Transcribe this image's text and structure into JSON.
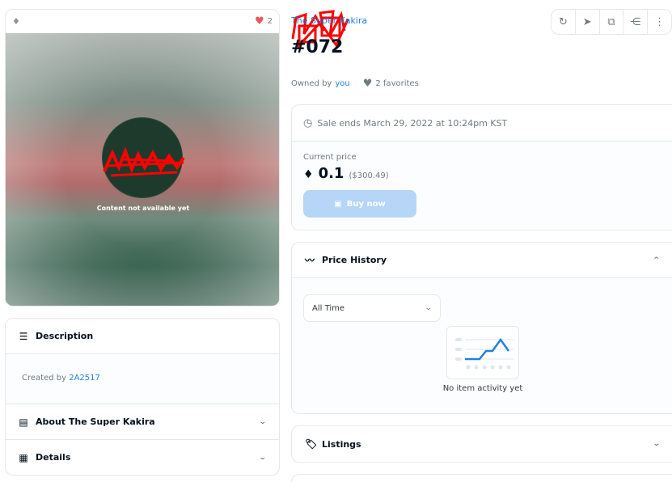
{
  "media": {
    "chain_icon": "ethereum-icon",
    "favorite_count": "2",
    "caption": "Content not available yet"
  },
  "description": {
    "header": "Description",
    "created_by_label": "Created by",
    "creator": "2A2517"
  },
  "about": {
    "header": "About The Super Kakira"
  },
  "details": {
    "header": "Details"
  },
  "item": {
    "collection_link": "The Super Kakira",
    "name": "#072",
    "owned_by_label": "Owned by",
    "owner": "you",
    "favorites": "2 favorites"
  },
  "toolbar": {
    "buttons": [
      "refresh-icon",
      "transfer-icon",
      "open-external-icon",
      "share-icon",
      "more-icon"
    ]
  },
  "sale": {
    "ends_text": "Sale ends March 29, 2022 at 10:24pm KST",
    "current_price_label": "Current price",
    "price": "0.1",
    "price_usd": "($300.49)",
    "buy_label": "Buy now"
  },
  "price_history": {
    "header": "Price History",
    "range_value": "All Time",
    "empty_text": "No item activity yet"
  },
  "listings": {
    "header": "Listings"
  },
  "colors": {
    "accent": "#2081e2",
    "buy_disabled": "#b5d6f6",
    "heart": "#eb5757"
  }
}
